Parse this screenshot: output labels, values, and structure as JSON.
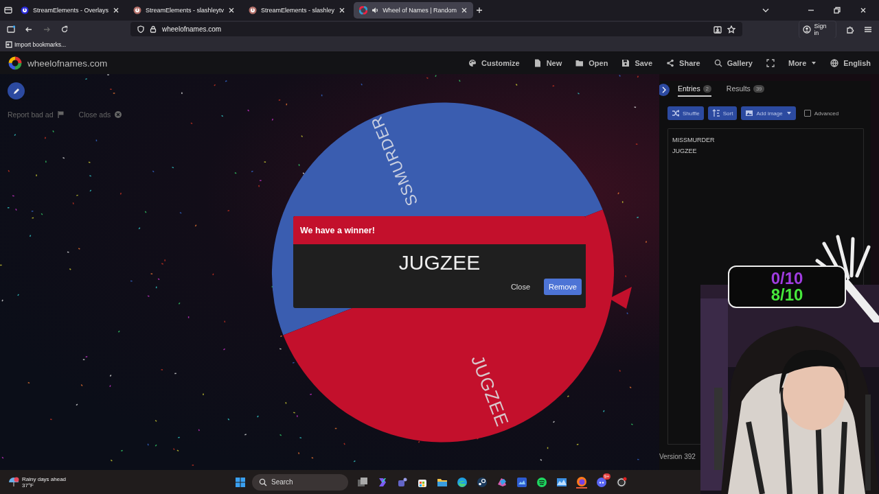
{
  "browser": {
    "tabs": [
      {
        "title": "StreamElements - Overlays",
        "selected": false
      },
      {
        "title": "StreamElements - slashleytv",
        "selected": false
      },
      {
        "title": "StreamElements - slashley",
        "selected": false
      },
      {
        "title": "Wheel of Names | Random",
        "selected": true
      }
    ],
    "url": "wheelofnames.com",
    "sign_in": "Sign in",
    "bookmarks": [
      "Import bookmarks..."
    ]
  },
  "site": {
    "logo": "wheelofnames.com",
    "menu": [
      {
        "label": "Customize",
        "kind": "button"
      },
      {
        "label": "New",
        "kind": "button"
      },
      {
        "label": "Open",
        "kind": "button"
      },
      {
        "label": "Save",
        "kind": "button"
      },
      {
        "label": "Share",
        "kind": "button"
      },
      {
        "label": "Gallery",
        "kind": "button"
      },
      {
        "kind": "icon"
      },
      {
        "label": "More",
        "kind": "dropdown"
      },
      {
        "label": "English",
        "kind": "button"
      }
    ]
  },
  "ads": {
    "report": "Report bad ad",
    "close": "Close ads"
  },
  "wheel": {
    "segments": [
      {
        "label": "SSMURDER",
        "color": "#3a5db0"
      },
      {
        "label": "JUGZEE",
        "color": "#c3102c"
      }
    ]
  },
  "dialog": {
    "title": "We have a winner!",
    "winner": "JUGZEE",
    "buttons": [
      {
        "label": "Close",
        "kind": "text"
      },
      {
        "label": "Remove",
        "kind": "primary"
      }
    ]
  },
  "panel": {
    "tabs": [
      {
        "label": "Entries",
        "count": "2",
        "selected": true
      },
      {
        "label": "Results",
        "count": "39",
        "selected": false
      }
    ],
    "tools": [
      {
        "label": "Shuffle",
        "kind": "button"
      },
      {
        "label": "Sort",
        "kind": "button"
      },
      {
        "label": "Add image",
        "kind": "dropdown"
      }
    ],
    "advanced": {
      "label": "Advanced",
      "checked": false
    },
    "entries": [
      "MISSMURDER",
      "JUGZEE"
    ],
    "version": "Version 392"
  },
  "overlay": {
    "counter": [
      "0/10",
      "8/10"
    ]
  },
  "taskbar": {
    "weather": {
      "title": "Rainy days ahead",
      "temp": "37°F"
    },
    "search": "Search",
    "badge": "9+"
  }
}
